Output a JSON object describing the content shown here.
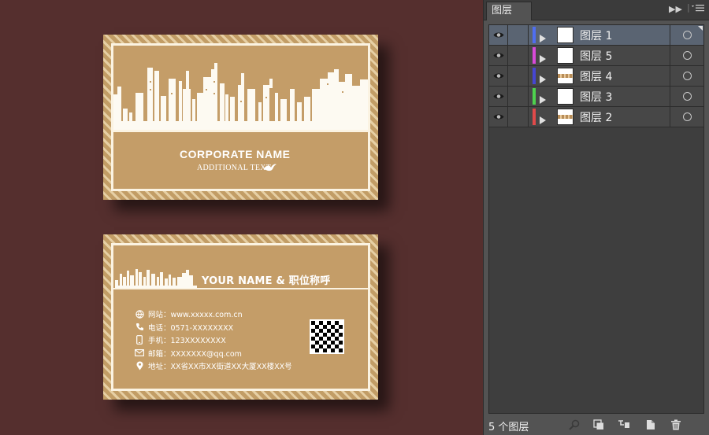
{
  "canvas": {
    "background_color": "#552f2e",
    "front_card": {
      "company_name": "CORPORATE NAME",
      "additional_text": "ADDITIONAL TEXT"
    },
    "back_card": {
      "headline": "YOUR NAME & 职位称呼",
      "contacts": [
        {
          "icon": "globe-icon",
          "text": "网站：www.xxxxx.com.cn"
        },
        {
          "icon": "phone-icon",
          "text": "电话：0571-XXXXXXXX"
        },
        {
          "icon": "mobile-icon",
          "text": "手机：123XXXXXXXX"
        },
        {
          "icon": "mail-icon",
          "text": "邮箱：XXXXXXX@qq.com"
        },
        {
          "icon": "location-icon",
          "text": "地址：XX省XX市XX街道XX大厦XX楼XX号"
        }
      ]
    }
  },
  "layers_panel": {
    "tab_label": "图层",
    "layers": [
      {
        "name": "图层 1",
        "color": "#4f6ef0",
        "selected": true,
        "thumb": "blank"
      },
      {
        "name": "图层 5",
        "color": "#d84ad8",
        "selected": false,
        "thumb": "blank"
      },
      {
        "name": "图层 4",
        "color": "#4646d2",
        "selected": false,
        "thumb": "city"
      },
      {
        "name": "图层 3",
        "color": "#4ed24e",
        "selected": false,
        "thumb": "blank"
      },
      {
        "name": "图层 2",
        "color": "#e04a4a",
        "selected": false,
        "thumb": "city"
      }
    ],
    "footer_count": "5 个图层"
  }
}
